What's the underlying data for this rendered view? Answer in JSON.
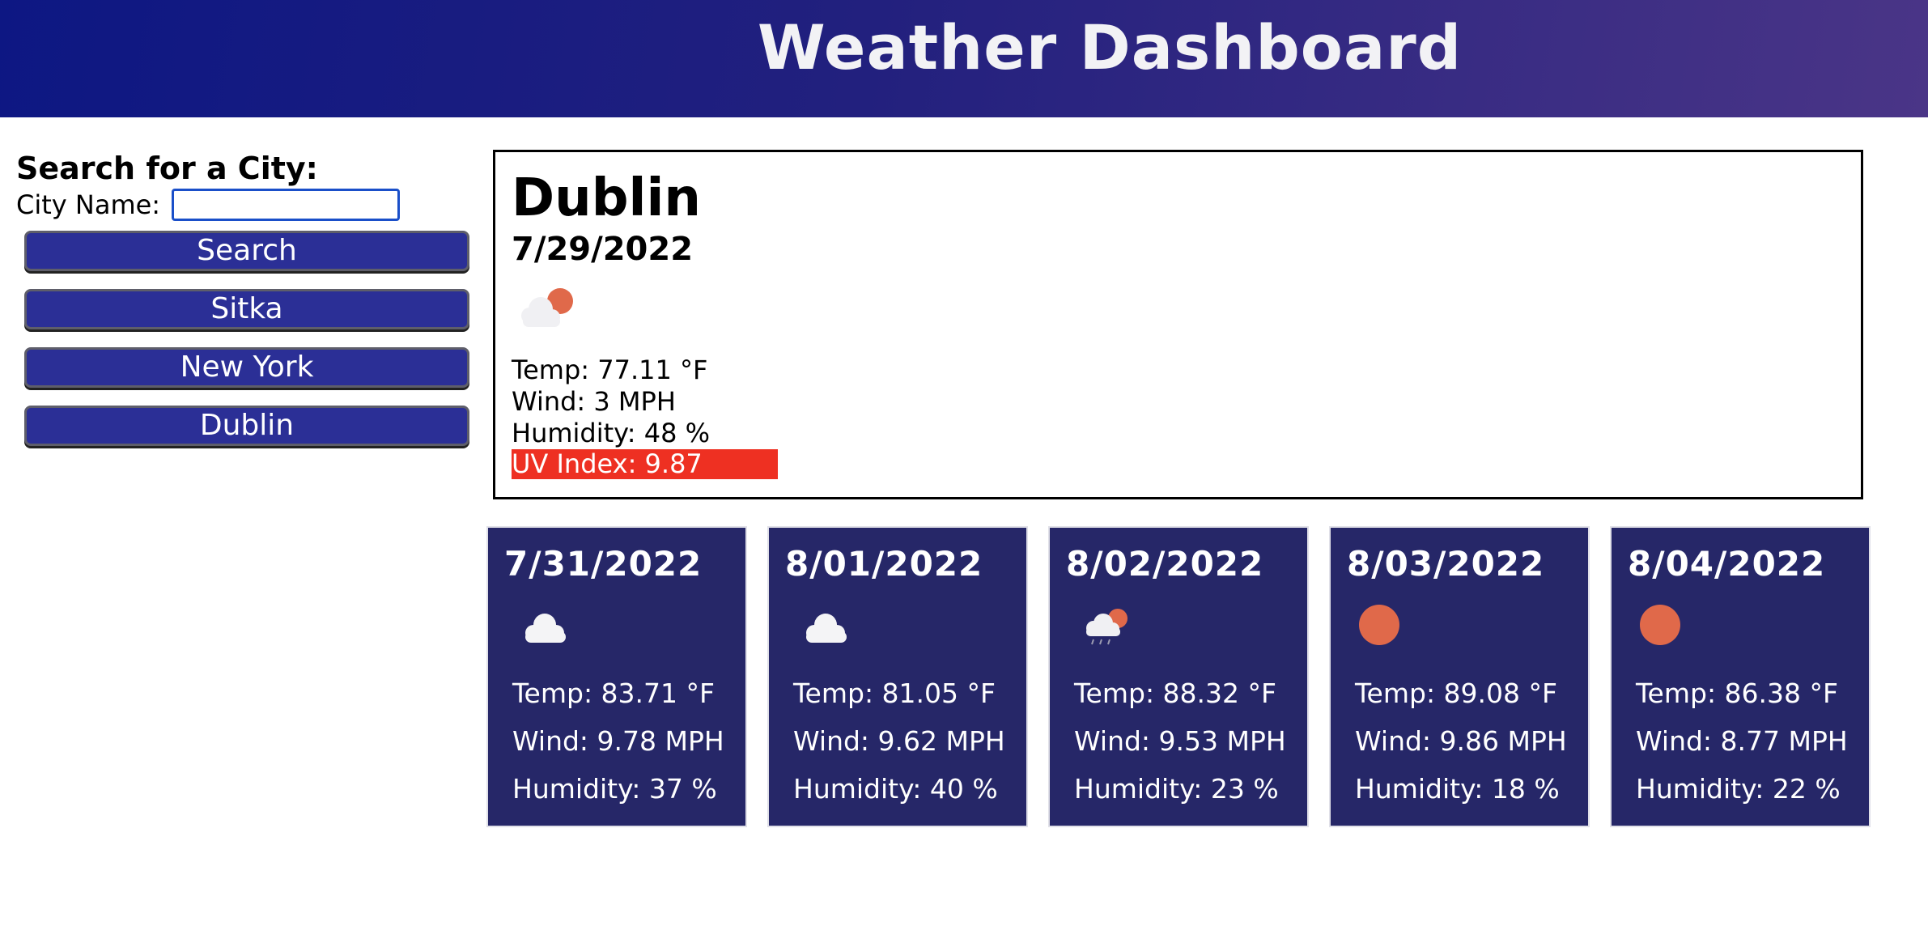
{
  "header": {
    "title": "Weather Dashboard"
  },
  "search": {
    "heading": "Search for a City:",
    "label": "City Name:",
    "input_value": "",
    "button_label": "Search",
    "history": [
      "Sitka",
      "New York",
      "Dublin"
    ]
  },
  "current": {
    "city": "Dublin",
    "date": "7/29/2022",
    "icon": "partly-cloudy-icon",
    "temp": "Temp: 77.11 °F",
    "wind": "Wind: 3 MPH",
    "humidity": "Humidity: 48 %",
    "uv": "UV Index: 9.87",
    "uv_color": "#ee3022"
  },
  "forecast": [
    {
      "date": "7/31/2022",
      "icon": "cloud-icon",
      "temp": "Temp: 83.71 °F",
      "wind": "Wind: 9.78 MPH",
      "humidity": "Humidity: 37 %"
    },
    {
      "date": "8/01/2022",
      "icon": "cloud-icon",
      "temp": "Temp: 81.05 °F",
      "wind": "Wind: 9.62 MPH",
      "humidity": "Humidity: 40 %"
    },
    {
      "date": "8/02/2022",
      "icon": "rain-sun-icon",
      "temp": "Temp: 88.32 °F",
      "wind": "Wind: 9.53 MPH",
      "humidity": "Humidity: 23 %"
    },
    {
      "date": "8/03/2022",
      "icon": "sun-icon",
      "temp": "Temp: 89.08 °F",
      "wind": "Wind: 9.86 MPH",
      "humidity": "Humidity: 18 %"
    },
    {
      "date": "8/04/2022",
      "icon": "sun-icon",
      "temp": "Temp: 86.38 °F",
      "wind": "Wind: 8.77 MPH",
      "humidity": "Humidity: 22 %"
    }
  ],
  "colors": {
    "header_gradient_start": "#0d1783",
    "header_gradient_end": "#4a3587",
    "button_bg": "#2b2f96",
    "card_bg": "#262768",
    "sun": "#e0694a"
  }
}
